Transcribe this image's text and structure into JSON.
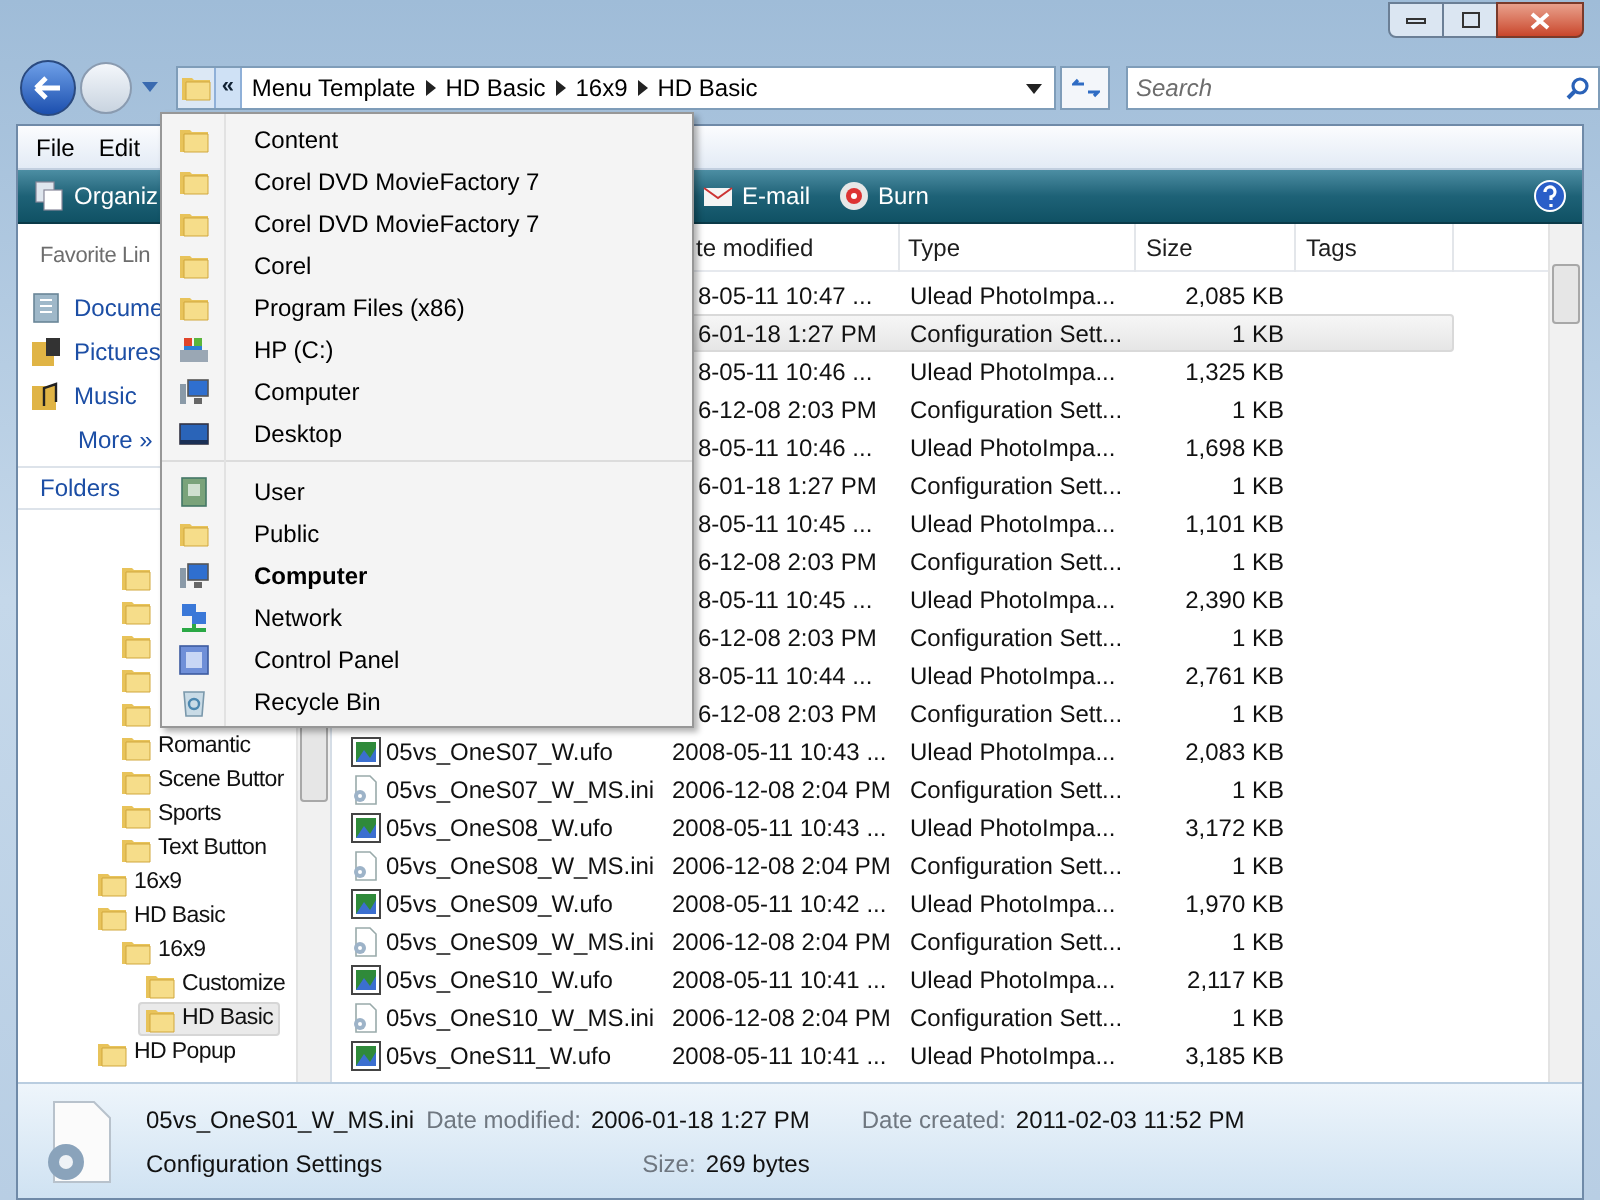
{
  "address_bar": {
    "overflow": "«",
    "crumbs": [
      "Menu Template",
      "HD Basic",
      "16x9",
      "HD Basic"
    ]
  },
  "search": {
    "placeholder": "Search"
  },
  "menu": [
    "File",
    "Edit"
  ],
  "toolbar": [
    {
      "label": "Organiz",
      "kind": "organize"
    },
    {
      "label": "E-mail",
      "kind": "email"
    },
    {
      "label": "Burn",
      "kind": "burn"
    }
  ],
  "favorites": {
    "title": "Favorite Lin",
    "items": [
      {
        "label": "Docume",
        "kind": "documents"
      },
      {
        "label": "Pictures",
        "kind": "pictures"
      },
      {
        "label": "Music",
        "kind": "music"
      },
      {
        "label": "More »",
        "kind": "more"
      }
    ]
  },
  "folders": {
    "title": "Folders",
    "tree": [
      {
        "children": [
          {
            "kind": "folder"
          },
          {
            "kind": "folder"
          },
          {
            "kind": "folder"
          },
          {
            "kind": "folder"
          },
          {
            "kind": "folder"
          },
          {
            "kind": "folder",
            "label": "Romantic",
            "selected": false
          },
          {
            "kind": "folder",
            "label": "Scene Buttor",
            "selected": false
          },
          {
            "kind": "folder",
            "label": "Sports",
            "selected": false
          },
          {
            "kind": "folder",
            "label": "Text Button",
            "selected": false
          }
        ]
      },
      {
        "kind": "folder",
        "label": "16x9",
        "selected": false
      },
      {
        "kind": "folder",
        "label": "HD Basic",
        "selected": false,
        "children": [
          {
            "kind": "folder",
            "label": "16x9",
            "selected": false,
            "children": [
              {
                "kind": "folder",
                "label": "Customize",
                "selected": false
              },
              {
                "kind": "folder",
                "label": "HD Basic",
                "selected": true
              }
            ]
          }
        ]
      },
      {
        "kind": "folder",
        "label": "HD Popup",
        "selected": false
      }
    ]
  },
  "columns": [
    "te modified",
    "Type",
    "Size",
    "Tags"
  ],
  "rows": [
    {
      "date": "8-05-11 10:47 ...",
      "type": "Ulead PhotoImpa...",
      "size": "2,085 KB",
      "selected": false
    },
    {
      "date": "6-01-18 1:27 PM",
      "type": "Configuration Sett...",
      "size": "1 KB",
      "selected": true
    },
    {
      "date": "8-05-11 10:46 ...",
      "type": "Ulead PhotoImpa...",
      "size": "1,325 KB",
      "selected": false
    },
    {
      "date": "6-12-08 2:03 PM",
      "type": "Configuration Sett...",
      "size": "1 KB",
      "selected": false
    },
    {
      "date": "8-05-11 10:46 ...",
      "type": "Ulead PhotoImpa...",
      "size": "1,698 KB",
      "selected": false
    },
    {
      "date": "6-01-18 1:27 PM",
      "type": "Configuration Sett...",
      "size": "1 KB",
      "selected": false
    },
    {
      "date": "8-05-11 10:45 ...",
      "type": "Ulead PhotoImpa...",
      "size": "1,101 KB",
      "selected": false
    },
    {
      "date": "6-12-08 2:03 PM",
      "type": "Configuration Sett...",
      "size": "1 KB",
      "selected": false
    },
    {
      "date": "8-05-11 10:45 ...",
      "type": "Ulead PhotoImpa...",
      "size": "2,390 KB",
      "selected": false
    },
    {
      "date": "6-12-08 2:03 PM",
      "type": "Configuration Sett...",
      "size": "1 KB",
      "selected": false
    },
    {
      "date": "8-05-11 10:44 ...",
      "type": "Ulead PhotoImpa...",
      "size": "2,761 KB",
      "selected": false
    },
    {
      "date": "6-12-08 2:03 PM",
      "type": "Configuration Sett...",
      "size": "1 KB",
      "selected": false
    },
    {
      "name": "05vs_OneS07_W.ufo",
      "kind": "image",
      "date": "2008-05-11 10:43 ...",
      "type": "Ulead PhotoImpa...",
      "size": "2,083 KB",
      "selected": false
    },
    {
      "name": "05vs_OneS07_W_MS.ini",
      "kind": "settings",
      "date": "2006-12-08 2:04 PM",
      "type": "Configuration Sett...",
      "size": "1 KB",
      "selected": false
    },
    {
      "name": "05vs_OneS08_W.ufo",
      "kind": "image",
      "date": "2008-05-11 10:43 ...",
      "type": "Ulead PhotoImpa...",
      "size": "3,172 KB",
      "selected": false
    },
    {
      "name": "05vs_OneS08_W_MS.ini",
      "kind": "settings",
      "date": "2006-12-08 2:04 PM",
      "type": "Configuration Sett...",
      "size": "1 KB",
      "selected": false
    },
    {
      "name": "05vs_OneS09_W.ufo",
      "kind": "image",
      "date": "2008-05-11 10:42 ...",
      "type": "Ulead PhotoImpa...",
      "size": "1,970 KB",
      "selected": false
    },
    {
      "name": "05vs_OneS09_W_MS.ini",
      "kind": "settings",
      "date": "2006-12-08 2:04 PM",
      "type": "Configuration Sett...",
      "size": "1 KB",
      "selected": false
    },
    {
      "name": "05vs_OneS10_W.ufo",
      "kind": "image",
      "date": "2008-05-11 10:41 ...",
      "type": "Ulead PhotoImpa...",
      "size": "2,117 KB",
      "selected": false
    },
    {
      "name": "05vs_OneS10_W_MS.ini",
      "kind": "settings",
      "date": "2006-12-08 2:04 PM",
      "type": "Configuration Sett...",
      "size": "1 KB",
      "selected": false
    },
    {
      "name": "05vs_OneS11_W.ufo",
      "kind": "image",
      "date": "2008-05-11 10:41 ...",
      "type": "Ulead PhotoImpa...",
      "size": "3,185 KB",
      "selected": false
    }
  ],
  "dropdown": {
    "groups": [
      [
        {
          "label": "Content",
          "kind": "folder",
          "current": false
        },
        {
          "label": "Corel DVD MovieFactory 7",
          "kind": "folder",
          "current": false
        },
        {
          "label": "Corel DVD MovieFactory 7",
          "kind": "folder",
          "current": false
        },
        {
          "label": "Corel",
          "kind": "folder",
          "current": false
        },
        {
          "label": "Program Files (x86)",
          "kind": "folder",
          "current": false
        },
        {
          "label": "HP (C:)",
          "kind": "drive",
          "current": false
        },
        {
          "label": "Computer",
          "kind": "computer",
          "current": false
        },
        {
          "label": "Desktop",
          "kind": "desktop",
          "current": false
        }
      ],
      [
        {
          "label": "User",
          "kind": "user",
          "current": false
        },
        {
          "label": "Public",
          "kind": "folder",
          "current": false
        },
        {
          "label": "Computer",
          "kind": "computer",
          "current": true
        },
        {
          "label": "Network",
          "kind": "network",
          "current": false
        },
        {
          "label": "Control Panel",
          "kind": "control-panel",
          "current": false
        },
        {
          "label": "Recycle Bin",
          "kind": "recycle-bin",
          "current": false
        }
      ]
    ]
  },
  "details": {
    "name": "05vs_OneS01_W_MS.ini",
    "type": "Configuration Settings",
    "fields": [
      {
        "label": "Date modified:",
        "value": "2006-01-18 1:27 PM"
      },
      {
        "label": "Size:",
        "value": "269 bytes"
      },
      {
        "label": "Date created:",
        "value": "2011-02-03 11:52 PM"
      }
    ]
  }
}
